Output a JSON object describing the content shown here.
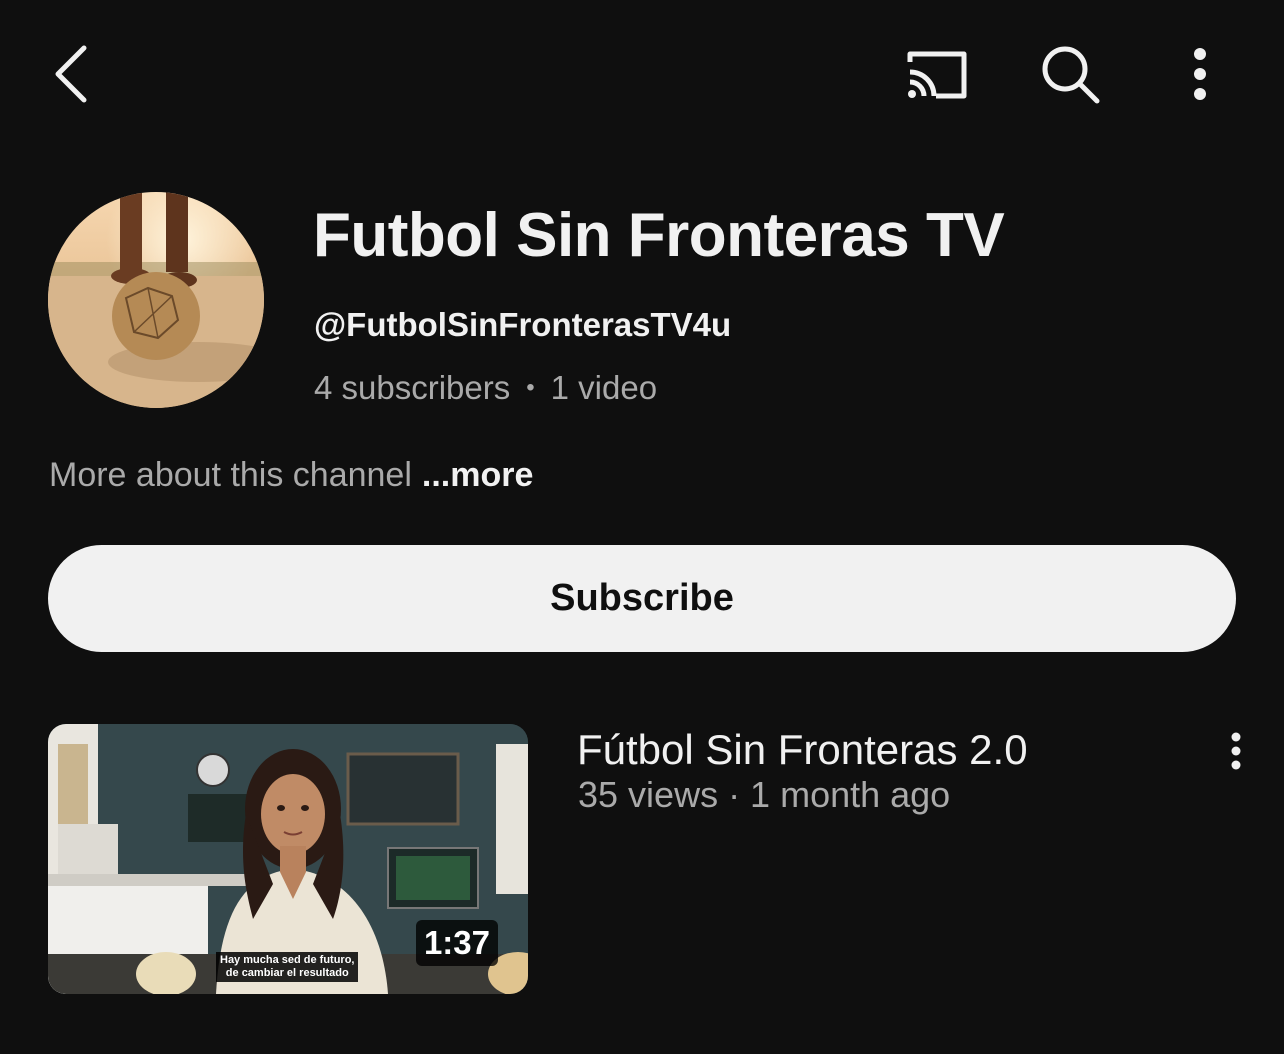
{
  "topbar": {
    "back_icon": "chevron-left-icon",
    "cast_icon": "cast-icon",
    "search_icon": "search-icon",
    "menu_icon": "more-vertical-icon"
  },
  "channel": {
    "name": "Futbol Sin Fronteras TV",
    "handle": "@FutbolSinFronterasTV4u",
    "subscribers": "4 subscribers",
    "separator": "•",
    "videos": "1 video",
    "about": "More about this channel",
    "more_link": "...more"
  },
  "subscribe_label": "Subscribe",
  "videos": [
    {
      "title": "Fútbol Sin Fronteras 2.0",
      "meta": "35 views · 1 month ago",
      "duration": "1:37",
      "caption_line1": "Hay mucha sed de futuro,",
      "caption_line2": "de cambiar el resultado"
    }
  ],
  "colors": {
    "background": "#0f0f0f",
    "text_primary": "#f1f1f1",
    "text_secondary": "#aaaaaa",
    "subscribe_bg": "#f1f1f1"
  }
}
